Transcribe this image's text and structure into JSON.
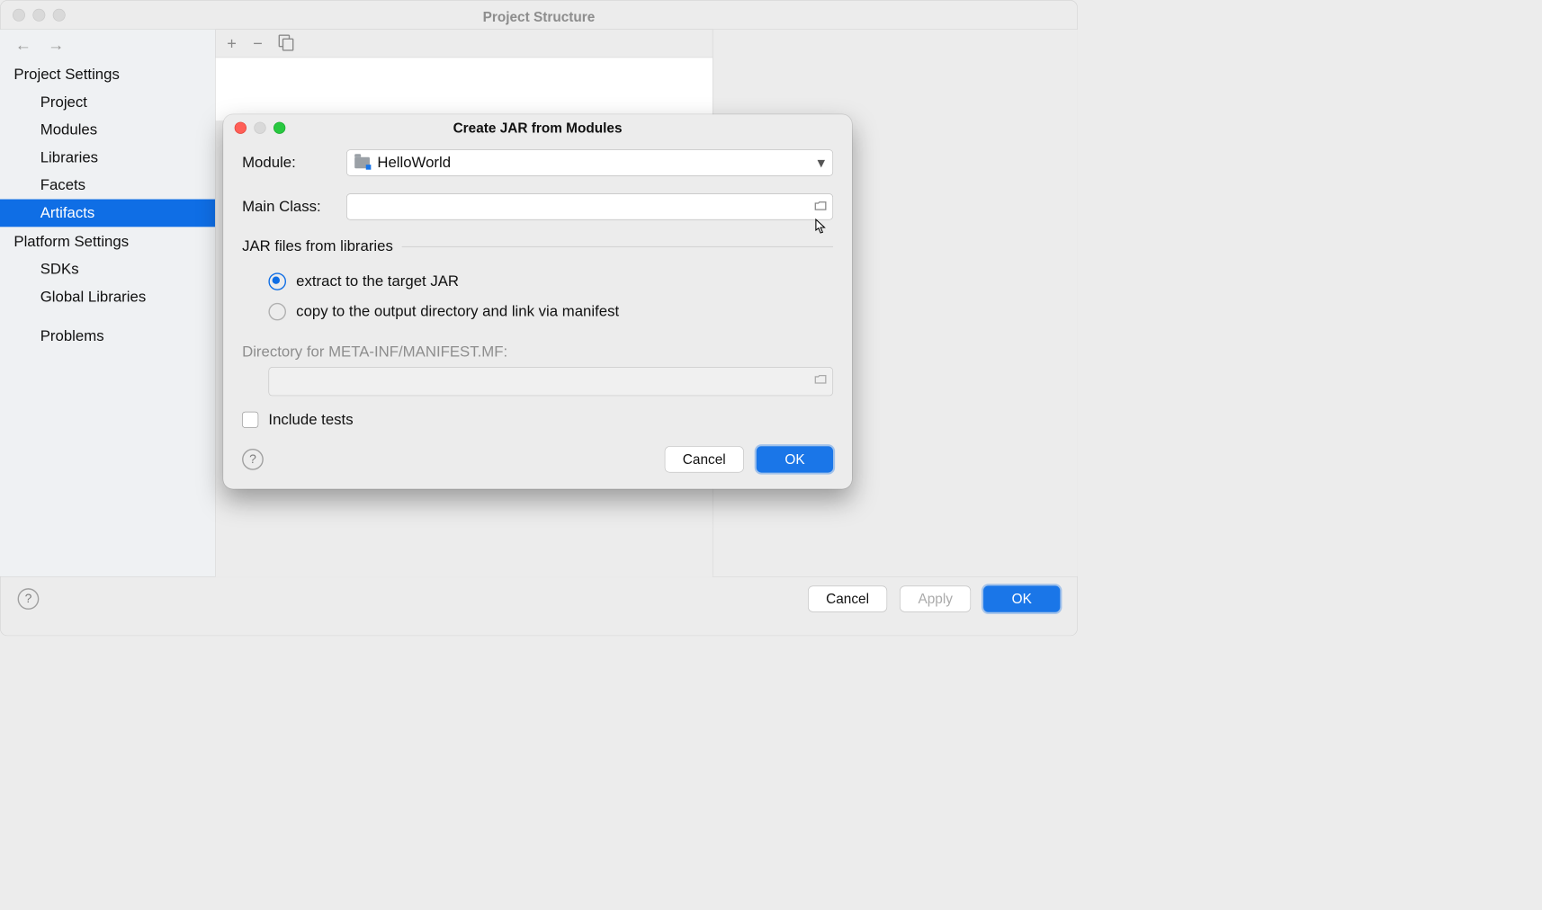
{
  "window": {
    "title": "Project Structure"
  },
  "sidebar": {
    "group1": "Project Settings",
    "items1": [
      "Project",
      "Modules",
      "Libraries",
      "Facets",
      "Artifacts"
    ],
    "selected": "Artifacts",
    "group2": "Platform Settings",
    "items2": [
      "SDKs",
      "Global Libraries"
    ],
    "problems": "Problems"
  },
  "toolbar": {
    "add": "+",
    "remove": "−"
  },
  "footer": {
    "cancel": "Cancel",
    "apply": "Apply",
    "ok": "OK"
  },
  "dialog": {
    "title": "Create JAR from Modules",
    "module_label": "Module:",
    "module_value": "HelloWorld",
    "mainclass_label": "Main Class:",
    "mainclass_value": "",
    "section_label": "JAR files from libraries",
    "radio1": "extract to the target JAR",
    "radio2": "copy to the output directory and link via manifest",
    "radio_selected": 1,
    "dir_label": "Directory for META-INF/MANIFEST.MF:",
    "dir_value": "",
    "include_tests": "Include tests",
    "cancel": "Cancel",
    "ok": "OK"
  }
}
